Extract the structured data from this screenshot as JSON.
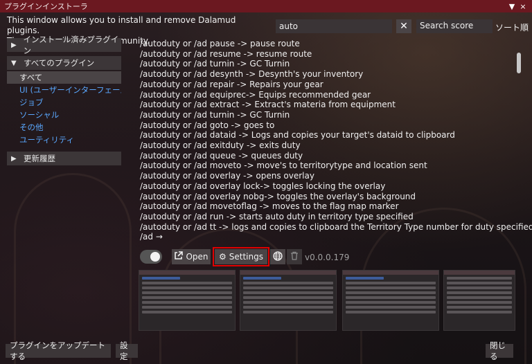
{
  "window": {
    "title": "プラグインインストーラ",
    "collapse_icon": "▼",
    "close_icon": "×"
  },
  "description": {
    "line1": "This window allows you to install and remove Dalamud plugins.",
    "line2": "They are made by the community."
  },
  "search": {
    "value": "auto",
    "clear_icon": "✕"
  },
  "sort": {
    "selected": "Search score",
    "label": "ソート順"
  },
  "sidebar": {
    "installed_header": "インストール済みプラグイン",
    "all_header": "すべてのプラグイン",
    "categories": [
      "すべて",
      "UI (ユーザーインターフェース)",
      "ジョブ",
      "ソーシャル",
      "その他",
      "ユーティリティ"
    ],
    "changelog_header": "更新履歴"
  },
  "plugin": {
    "description_lines": [
      "/autoduty or /ad pause -> pause route",
      "/autoduty or /ad resume -> resume route",
      "/autoduty or /ad turnin -> GC Turnin",
      "/autoduty or /ad desynth -> Desynth's your inventory",
      "/autoduty or /ad repair -> Repairs your gear",
      "/autoduty or /ad equiprec-> Equips recommended gear",
      "/autoduty or /ad extract -> Extract's materia from equipment",
      "/autoduty or /ad turnin -> GC Turnin",
      "/autoduty or /ad goto -> goes to",
      "/autoduty or /ad dataid -> Logs and copies your target's dataid to clipboard",
      "/autoduty or /ad exitduty -> exits duty",
      "/autoduty or /ad queue -> queues duty",
      "/autoduty or /ad moveto -> move's to territorytype and location sent",
      "/autoduty or /ad overlay -> opens overlay",
      "/autoduty or /ad overlay lock-> toggles locking the overlay",
      "/autoduty or /ad overlay nobg-> toggles the overlay's background",
      "/autoduty or /ad movetoflag -> moves to the flag map marker",
      "/autoduty or /ad run -> starts auto duty in territory type specified",
      "/autoduty or /ad tt -> logs and copies to clipboard the Territory Type number for duty specified",
      "/ad →"
    ],
    "open_label": "Open",
    "settings_label": "Settings",
    "version": "v0.0.0.179"
  },
  "footer": {
    "update_label": "プラグインをアップデートする",
    "settings_label": "設定",
    "close_label": "閉じる"
  },
  "colors": {
    "titlebar": "#6b1820",
    "link": "#5aa8ff",
    "highlight": "#e00000"
  }
}
